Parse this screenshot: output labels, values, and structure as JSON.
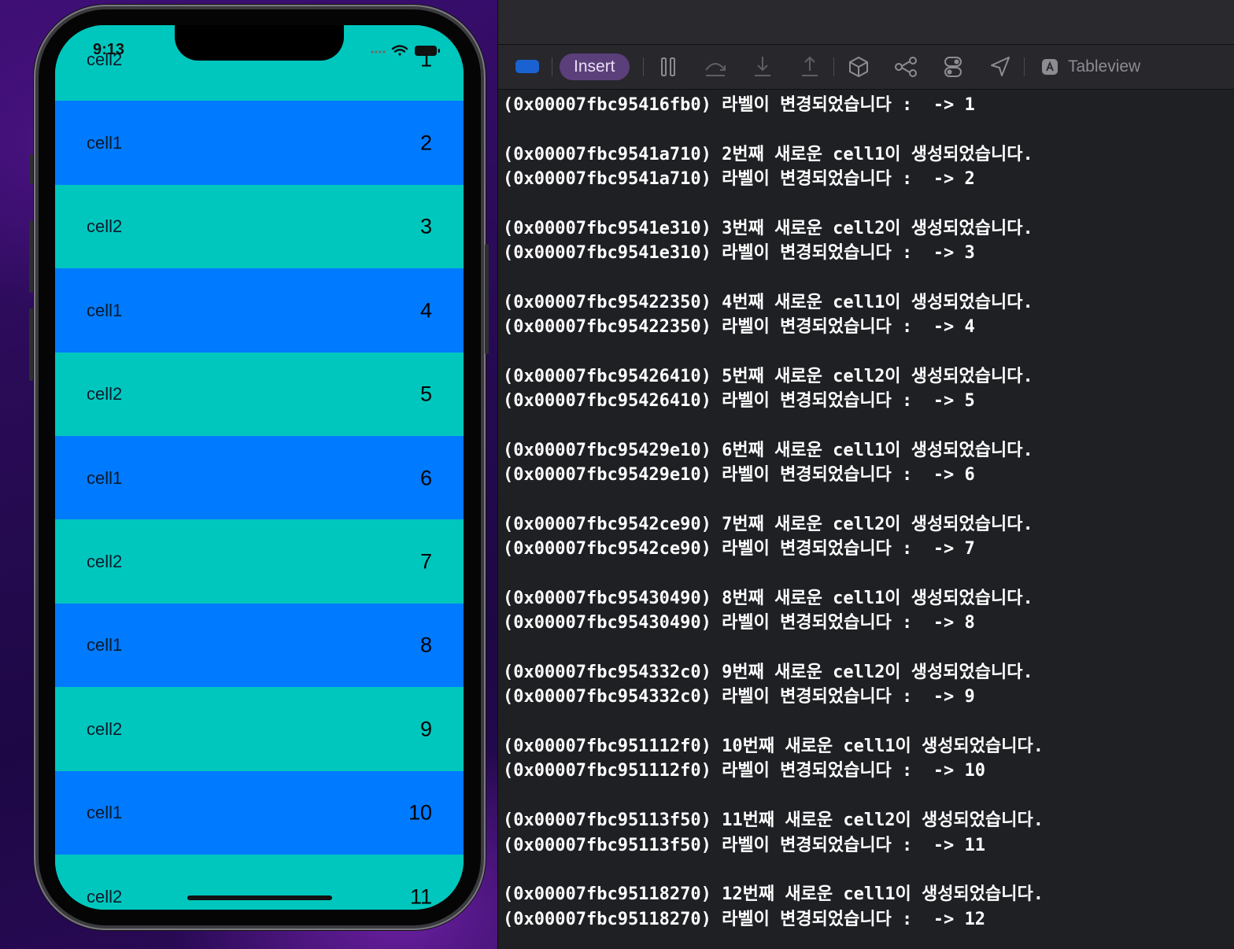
{
  "simulator": {
    "status_time": "9:13",
    "rows": [
      {
        "label": "cell2",
        "number": "1",
        "color": "teal"
      },
      {
        "label": "cell1",
        "number": "2",
        "color": "blue"
      },
      {
        "label": "cell2",
        "number": "3",
        "color": "teal"
      },
      {
        "label": "cell1",
        "number": "4",
        "color": "blue"
      },
      {
        "label": "cell2",
        "number": "5",
        "color": "teal"
      },
      {
        "label": "cell1",
        "number": "6",
        "color": "blue"
      },
      {
        "label": "cell2",
        "number": "7",
        "color": "teal"
      },
      {
        "label": "cell1",
        "number": "8",
        "color": "blue"
      },
      {
        "label": "cell2",
        "number": "9",
        "color": "teal"
      },
      {
        "label": "cell1",
        "number": "10",
        "color": "blue"
      },
      {
        "label": "cell2",
        "number": "11",
        "color": "teal"
      }
    ]
  },
  "colors": {
    "teal": "#00c7be",
    "blue": "#007aff",
    "console_bg": "#1f2024",
    "insert_pill": "#5b3f7a"
  },
  "toolbar": {
    "insert_label": "Insert",
    "scheme_label": "Tableview",
    "icons": [
      "tag-icon",
      "pause-icon",
      "step-over-icon",
      "step-into-icon",
      "step-out-icon",
      "cube-icon",
      "graph-icon",
      "toggle-icon",
      "location-icon",
      "app-store-icon"
    ]
  },
  "console": {
    "lines": [
      "(0x00007fbc95416fb0) 라벨이 변경되었습니다 :  -> 1",
      "",
      "(0x00007fbc9541a710) 2번째 새로운 cell1이 생성되었습니다.",
      "(0x00007fbc9541a710) 라벨이 변경되었습니다 :  -> 2",
      "",
      "(0x00007fbc9541e310) 3번째 새로운 cell2이 생성되었습니다.",
      "(0x00007fbc9541e310) 라벨이 변경되었습니다 :  -> 3",
      "",
      "(0x00007fbc95422350) 4번째 새로운 cell1이 생성되었습니다.",
      "(0x00007fbc95422350) 라벨이 변경되었습니다 :  -> 4",
      "",
      "(0x00007fbc95426410) 5번째 새로운 cell2이 생성되었습니다.",
      "(0x00007fbc95426410) 라벨이 변경되었습니다 :  -> 5",
      "",
      "(0x00007fbc95429e10) 6번째 새로운 cell1이 생성되었습니다.",
      "(0x00007fbc95429e10) 라벨이 변경되었습니다 :  -> 6",
      "",
      "(0x00007fbc9542ce90) 7번째 새로운 cell2이 생성되었습니다.",
      "(0x00007fbc9542ce90) 라벨이 변경되었습니다 :  -> 7",
      "",
      "(0x00007fbc95430490) 8번째 새로운 cell1이 생성되었습니다.",
      "(0x00007fbc95430490) 라벨이 변경되었습니다 :  -> 8",
      "",
      "(0x00007fbc954332c0) 9번째 새로운 cell2이 생성되었습니다.",
      "(0x00007fbc954332c0) 라벨이 변경되었습니다 :  -> 9",
      "",
      "(0x00007fbc951112f0) 10번째 새로운 cell1이 생성되었습니다.",
      "(0x00007fbc951112f0) 라벨이 변경되었습니다 :  -> 10",
      "",
      "(0x00007fbc95113f50) 11번째 새로운 cell2이 생성되었습니다.",
      "(0x00007fbc95113f50) 라벨이 변경되었습니다 :  -> 11",
      "",
      "(0x00007fbc95118270) 12번째 새로운 cell1이 생성되었습니다.",
      "(0x00007fbc95118270) 라벨이 변경되었습니다 :  -> 12"
    ]
  }
}
